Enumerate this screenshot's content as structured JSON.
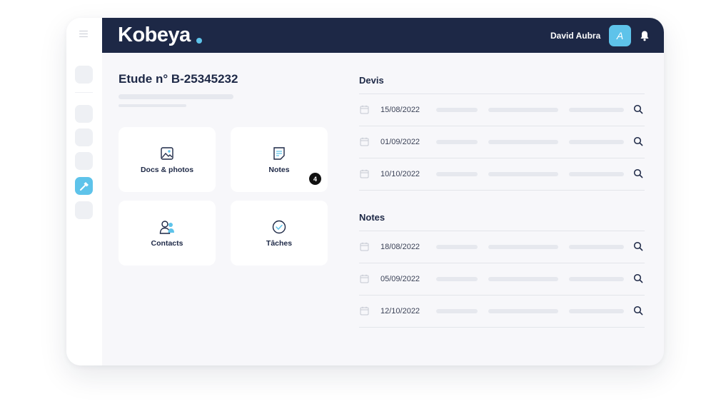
{
  "app": {
    "logo_text": "Kobeya",
    "user_name": "David Aubra",
    "avatar_initial": "A"
  },
  "colors": {
    "topbar": "#1d2846",
    "accent": "#5ec3ea",
    "background": "#f7f7fa"
  },
  "icons": {
    "menu": "hamburger-icon",
    "active_side": "hammer-icon",
    "notifications": "bell-icon",
    "docs": "image-icon",
    "notes": "note-icon",
    "contacts": "people-icon",
    "tasks": "check-circle-icon",
    "date": "calendar-icon",
    "view": "search-icon"
  },
  "study": {
    "title": "Etude n° B-25345232"
  },
  "cards": [
    {
      "label": "Docs & photos",
      "badge": ""
    },
    {
      "label": "Notes",
      "badge": "4"
    },
    {
      "label": "Contacts",
      "badge": ""
    },
    {
      "label": "Tâches",
      "badge": ""
    }
  ],
  "devis": {
    "title": "Devis",
    "rows": [
      {
        "date": "15/08/2022"
      },
      {
        "date": "01/09/2022"
      },
      {
        "date": "10/10/2022"
      }
    ]
  },
  "notes": {
    "title": "Notes",
    "rows": [
      {
        "date": "18/08/2022"
      },
      {
        "date": "05/09/2022"
      },
      {
        "date": "12/10/2022"
      }
    ]
  }
}
